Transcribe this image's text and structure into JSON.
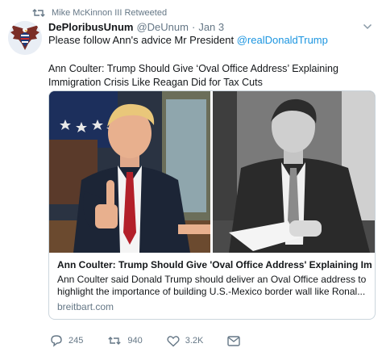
{
  "retweet": {
    "icon": "retweet-icon",
    "text": "Mike McKinnon III Retweeted"
  },
  "author": {
    "avatar": "eagle-avatar",
    "display_name": "DePloribusUnum",
    "handle": "@DeUnum",
    "separator": "·",
    "time": "Jan 3"
  },
  "tweet": {
    "text_prefix": "Please follow Ann's advice Mr President ",
    "mention": "@realDonaldTrump"
  },
  "headline": "Ann Coulter: Trump Should Give ‘Oval Office Address’ Explaining Immigration Crisis Like Reagan Did for Tax Cuts",
  "card": {
    "title": "Ann Coulter: Trump Should Give 'Oval Office Address' Explaining Im...",
    "description": "Ann Coulter said Donald Trump should deliver an Oval Office address to highlight the importance of building U.S.-Mexico border wall like Ronal...",
    "domain": "breitbart.com"
  },
  "actions": {
    "reply": {
      "icon": "reply-icon",
      "count": "245"
    },
    "retweet": {
      "icon": "retweet-icon",
      "count": "940"
    },
    "like": {
      "icon": "heart-icon",
      "count": "3.2K"
    },
    "message": {
      "icon": "envelope-icon"
    }
  },
  "colors": {
    "link": "#1b95e0",
    "muted": "#657786",
    "text": "#14171a",
    "border": "#ccd6dd"
  }
}
